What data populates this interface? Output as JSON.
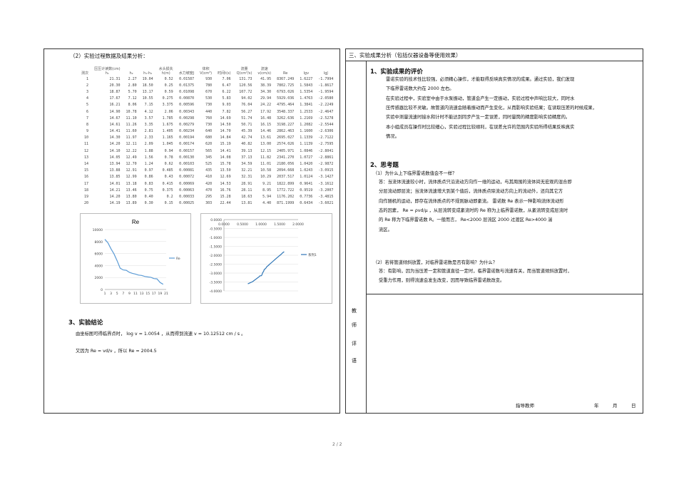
{
  "left": {
    "section_title": "（2）实验过程数据及结果分析：",
    "table": {
      "headers": [
        "测次",
        "压压计读数(cm)\nh₁",
        "h₂",
        "h₁-h₂",
        "水头损失\nh(m)",
        "水力坡度J",
        "体积\nV(cm³)",
        "时间t(s)",
        "流量\nQ(cm³/s)",
        "流速\nv(cm/s)",
        "Re",
        "lgv",
        "lgJ"
      ],
      "rows": [
        [
          "1",
          "21.31",
          "2.27",
          "19.04",
          "0.52",
          "0.01587",
          "930",
          "7.06",
          "131.73",
          "41.95",
          "8367.249",
          "1.6227",
          "-1.7994"
        ],
        [
          "2",
          "20.30",
          "2.80",
          "18.50",
          "0.25",
          "0.01375",
          "780",
          "6.47",
          "120.56",
          "38.39",
          "7802.725",
          "1.5843",
          "-1.8617"
        ],
        [
          "3",
          "18.87",
          "5.70",
          "13.17",
          "0.59",
          "0.01098",
          "670",
          "6.22",
          "107.72",
          "34.30",
          "6793.026",
          "1.5354",
          "-1.9594"
        ],
        [
          "4",
          "17.67",
          "7.12",
          "10.55",
          "0.275",
          "0.00870",
          "530",
          "5.83",
          "94.02",
          "29.94",
          "5929.036",
          "1.4763",
          "-2.0580"
        ],
        [
          "5",
          "16.21",
          "8.06",
          "7.15",
          "3.375",
          "0.00596",
          "730",
          "9.03",
          "76.04",
          "24.22",
          "4795.464",
          "1.3841",
          "-2.2249"
        ],
        [
          "6",
          "14.90",
          "10.78",
          "4.12",
          "2.06",
          "0.00343",
          "440",
          "7.82",
          "56.27",
          "17.92",
          "3548.337",
          "1.2533",
          "-2.4647"
        ],
        [
          "7",
          "14.67",
          "11.10",
          "3.57",
          "1.785",
          "0.00298",
          "760",
          "14.69",
          "51.74",
          "16.48",
          "3262.636",
          "1.2169",
          "-2.5278"
        ],
        [
          "8",
          "14.61",
          "11.26",
          "3.35",
          "1.675",
          "0.00279",
          "730",
          "14.50",
          "50.71",
          "16.15",
          "3198.227",
          "1.2082",
          "-2.5544"
        ],
        [
          "9",
          "14.41",
          "11.60",
          "2.81",
          "1.405",
          "0.00234",
          "640",
          "14.70",
          "45.39",
          "14.46",
          "2862.463",
          "1.1600",
          "-2.6306"
        ],
        [
          "10",
          "14.30",
          "11.97",
          "2.33",
          "1.165",
          "0.00194",
          "680",
          "14.84",
          "42.74",
          "13.61",
          "2695.027",
          "1.1339",
          "-2.7122"
        ],
        [
          "11",
          "14.20",
          "12.11",
          "2.09",
          "1.045",
          "0.00174",
          "620",
          "15.19",
          "40.82",
          "13.00",
          "2574.026",
          "1.1139",
          "-2.7595"
        ],
        [
          "12",
          "14.10",
          "12.22",
          "1.88",
          "0.94",
          "0.00157",
          "565",
          "14.41",
          "39.13",
          "12.15",
          "2405.971",
          "1.0846",
          "-2.8041"
        ],
        [
          "13",
          "14.05",
          "12.49",
          "1.56",
          "0.78",
          "0.00130",
          "345",
          "14.08",
          "37.13",
          "11.82",
          "2341.270",
          "1.0727",
          "-2.8861"
        ],
        [
          "14",
          "13.94",
          "12.70",
          "1.24",
          "0.62",
          "0.00103",
          "525",
          "15.78",
          "34.59",
          "11.01",
          "2180.056",
          "1.0420",
          "-2.9872"
        ],
        [
          "15",
          "13.88",
          "12.91",
          "0.97",
          "0.485",
          "0.00081",
          "435",
          "13.50",
          "32.21",
          "10.58",
          "2094.668",
          "1.0243",
          "-3.0915"
        ],
        [
          "16",
          "13.85",
          "12.99",
          "0.86",
          "0.43",
          "0.00072",
          "410",
          "12.69",
          "32.31",
          "10.29",
          "2037.517",
          "1.0124",
          "-3.1427"
        ],
        [
          "17",
          "14.01",
          "13.18",
          "0.83",
          "0.415",
          "0.00069",
          "420",
          "14.53",
          "28.91",
          "9.21",
          "1822.899",
          "0.9641",
          "-3.1612"
        ],
        [
          "18",
          "14.21",
          "13.46",
          "0.75",
          "0.375",
          "0.00063",
          "470",
          "16.76",
          "28.11",
          "8.95",
          "1772.722",
          "0.9519",
          "-3.2007"
        ],
        [
          "19",
          "14.20",
          "13.80",
          "0.40",
          "0.2",
          "0.00033",
          "295",
          "15.28",
          "18.63",
          "5.94",
          "1176.202",
          "0.7736",
          "-3.4815"
        ],
        [
          "20",
          "14.19",
          "13.89",
          "0.30",
          "0.15",
          "0.00025",
          "303",
          "22.44",
          "13.81",
          "4.40",
          "871.1999",
          "0.6434",
          "-3.6021"
        ]
      ]
    },
    "chart1": {
      "title": "Re",
      "legend": "Re",
      "yticks": [
        "10000",
        "8000",
        "6000",
        "4000",
        "2000",
        "0"
      ],
      "xticks": [
        "1",
        "3",
        "5",
        "7",
        "9",
        "11",
        "13",
        "15",
        "17",
        "19",
        "21"
      ]
    },
    "chart2": {
      "legend": "系列1",
      "yticks": [
        "0.0000",
        "-0.5000",
        "-1.0000",
        "-1.5000",
        "-2.0000",
        "-2.5000",
        "-3.0000",
        "-3.5000",
        "-4.0000"
      ],
      "xticks": [
        "0.0000",
        "0.5000",
        "1.0000",
        "1.5000",
        "2.0000"
      ]
    },
    "conclusion_heading": "3、实验结论",
    "conclusion_line1": "由坐标图可得临界点时，  log v = 1.0054 ，从而得到流速 v = 10.12512 cm / s 。",
    "conclusion_line2": "又因为 Re = vd/ν ，所以 Re = 2004.5"
  },
  "right": {
    "header": "三、实验成果分析（包括仪器设备等使用效果）",
    "h1": "1、实验成果的评价",
    "p1": [
      "雷诺实验的技术性比较强，必须精心操作，才能取得反映真实情况的成果。通过实验，我们发现",
      "下临界雷诺数大约在 2000 左右。",
      "在实验过程中，实验室中由于水泵振动，管道会产生一定振动，实验过程中声响比较大，同时水",
      "压传感器比较不灵敏。故管道内流速会随着振动而产生变化，从而影响实验结果；在读取压差的时候成果，",
      "实验中测量流速时接水和计时不能达到同步产生一定误差，同时量筒的精度影响实验精度的。",
      "本小组成员在操作时比较细心，实验过程比较顺利，在误差允许的范围内实验所得结果反映真实",
      "情况。"
    ],
    "h2": "2、思考题",
    "q1": "（1）为什么上下临界雷诺数值会不一样？",
    "a1": [
      "答：当流体流速较小时，流体质点只沿流动方向作一维的运动，与其周围的流体间无宏观的混合即",
      "分层流动即层流；当流体流速增大到某个值后，流体质点除流动方向上的流动外，还向其它方",
      "向作随机的运动，即存在流体质点的不规则脉动即紊流。     雷诺数 Re 表示一种影响流体流动形",
      "态的因素，  Re = ρvd/μ ，从层流转变成紊流时的 Re 称为上临界雷诺数，从紊流转变成层流时",
      "的 Re 称为下临界雷诺数 R。一般而言，  Re<2000 层流区    2000         过渡区  Re>4000  湍",
      "流区。"
    ],
    "q2": "（2）若将管道倾斜放置，对临界雷诺数是否有影响？为什么？",
    "a2": [
      "答：有影响，因为当压差一定和管道直径一定时，临界雷诺数与流速有关，而当管道倾斜放置时，",
      "受重力作用，则得流速会发生改变，因而导致临界雷诺数改变。"
    ],
    "side_label": [
      "教",
      "师",
      "评",
      "语"
    ],
    "footer_sign": "指导教师",
    "footer_year": "年",
    "footer_month": "月",
    "footer_day": "日"
  },
  "page_number": "2 / 2"
}
